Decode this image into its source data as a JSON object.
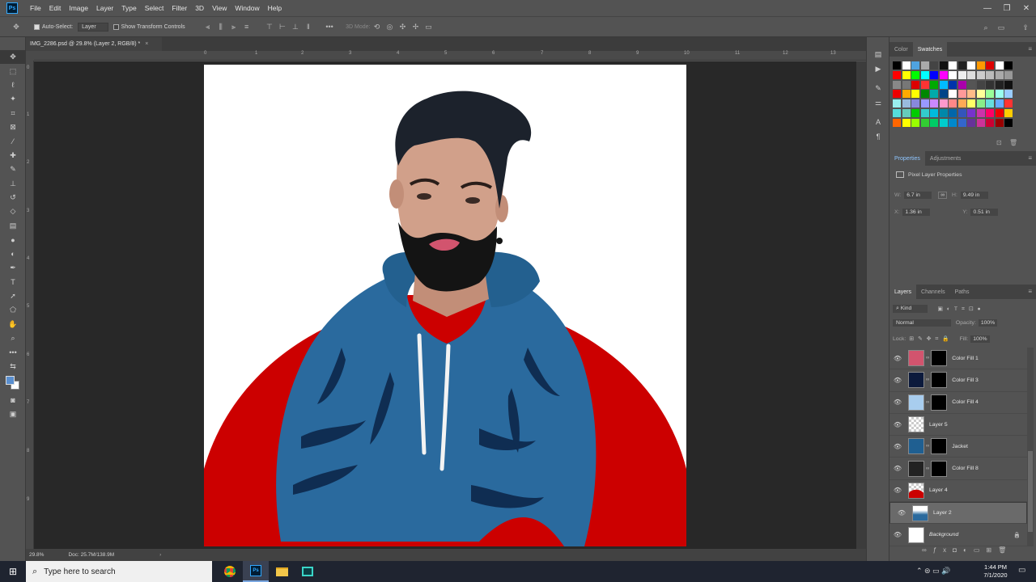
{
  "app": {
    "logo": "Ps",
    "menus": [
      "File",
      "Edit",
      "Image",
      "Layer",
      "Type",
      "Select",
      "Filter",
      "3D",
      "View",
      "Window",
      "Help"
    ],
    "window_controls": [
      "—",
      "❐",
      "✕"
    ]
  },
  "options_bar": {
    "auto_select_label": "Auto-Select:",
    "auto_select_target": "Layer",
    "show_transform_label": "Show Transform Controls",
    "mode_3d_label": "3D Mode:"
  },
  "document": {
    "tab_title": "IMG_2286.psd @ 29.8% (Layer 2, RGB/8) *",
    "tab_close": "×",
    "zoom": "29.8%",
    "doc_info": "Doc: 25.7M/138.9M"
  },
  "rulers": {
    "top": [
      "0",
      "1",
      "2",
      "3",
      "4",
      "5",
      "6",
      "7",
      "8",
      "9",
      "10",
      "11",
      "12",
      "13"
    ],
    "left": [
      "0",
      "1",
      "2",
      "3",
      "4",
      "5",
      "6",
      "7",
      "8",
      "9"
    ]
  },
  "swatches_panel": {
    "tabs": [
      "Color",
      "Swatches"
    ],
    "active_tab": "Swatches"
  },
  "properties_panel": {
    "tabs": [
      "Properties",
      "Adjustments"
    ],
    "subtitle": "Pixel Layer Properties",
    "w_label": "W:",
    "w_value": "6.7 in",
    "h_label": "H:",
    "h_value": "9.49 in",
    "x_label": "X:",
    "x_value": "1.36 in",
    "y_label": "Y:",
    "y_value": "0.51 in"
  },
  "layers_panel": {
    "tabs": [
      "Layers",
      "Channels",
      "Paths"
    ],
    "filter_label": "Kind",
    "blend_mode": "Normal",
    "opacity_label": "Opacity:",
    "opacity_value": "100%",
    "lock_label": "Lock:",
    "fill_label": "Fill:",
    "fill_value": "100%",
    "layers": [
      {
        "name": "Color Fill 1",
        "thumb": "#d2546e",
        "mask": true,
        "selected": false
      },
      {
        "name": "Color Fill 3",
        "thumb": "#0c1a3c",
        "mask": true,
        "selected": false
      },
      {
        "name": "Color Fill 4",
        "thumb": "#a8cdee",
        "mask": true,
        "selected": false
      },
      {
        "name": "Layer 5",
        "thumb": "checker",
        "mask": false,
        "selected": false
      },
      {
        "name": "Jacket",
        "thumb": "#1f5f91",
        "mask": true,
        "selected": false
      },
      {
        "name": "Color Fill 8",
        "thumb": "#222222",
        "mask": true,
        "selected": false
      },
      {
        "name": "Layer 4",
        "thumb": "checker-red",
        "mask": false,
        "selected": false
      },
      {
        "name": "Layer 2",
        "thumb": "photo",
        "mask": false,
        "selected": true
      },
      {
        "name": "Background",
        "thumb": "#ffffff",
        "mask": false,
        "selected": false
      }
    ]
  },
  "taskbar": {
    "search_placeholder": "Type here to search",
    "time": "1:44 PM",
    "date": "7/1/2020"
  },
  "colors": {
    "canvas_red": "#cc0000",
    "hoodie_blue": "#2a6a9e",
    "hoodie_dark": "#0f2d52",
    "beard": "#141414",
    "lips": "#d2546e"
  }
}
